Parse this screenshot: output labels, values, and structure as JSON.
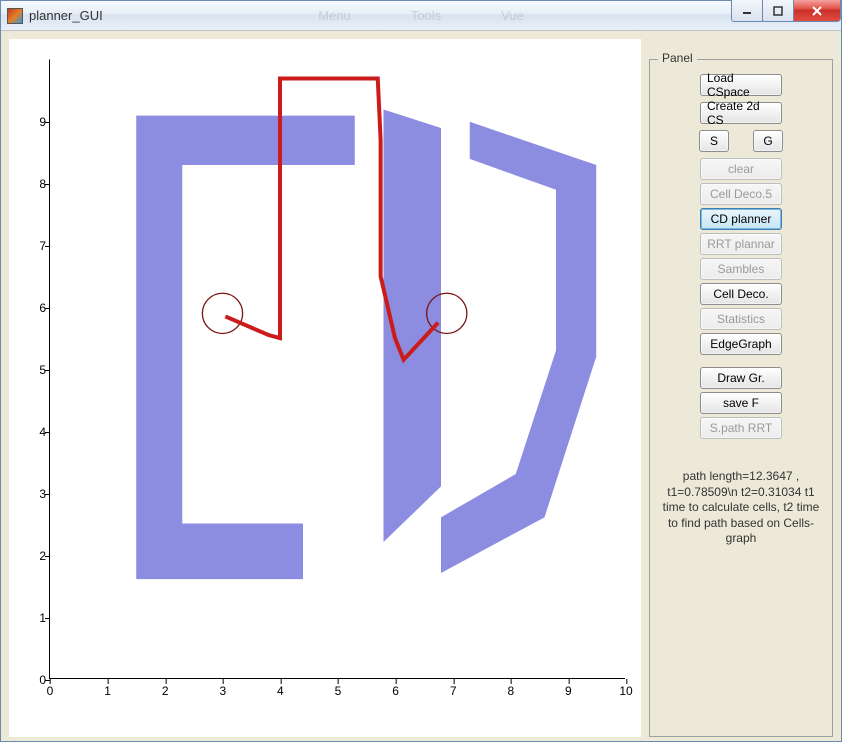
{
  "window": {
    "title": "planner_GUI",
    "ghost_menu": [
      "Menu",
      "Tools",
      "Vue"
    ]
  },
  "panel": {
    "title": "Panel",
    "buttons": {
      "load_cspace": "Load CSpace",
      "create_2d_cs": "Create 2d CS",
      "s": "S",
      "g": "G",
      "clear": "clear",
      "cell_deco5": "Cell Deco.5",
      "cd_planner": "CD planner",
      "rrt_planner": "RRT plannar",
      "sambles": "Sambles",
      "cell_deco": "Cell Deco.",
      "statistics": "Statistics",
      "edgegraph": "EdgeGraph",
      "draw_gr": "Draw Gr.",
      "save_f": "save F",
      "spath_rrt": "S.path RRT"
    },
    "status": "path length=12.3647 , t1=0.78509\\n t2=0.31034 t1 time to calculate cells, t2 time to find path based on Cells-graph"
  },
  "chart_data": {
    "type": "line",
    "title": "",
    "xlabel": "",
    "ylabel": "",
    "xlim": [
      0,
      10
    ],
    "ylim": [
      0,
      10
    ],
    "xticks": [
      0,
      1,
      2,
      3,
      4,
      5,
      6,
      7,
      8,
      9,
      10
    ],
    "yticks": [
      0,
      1,
      2,
      3,
      4,
      5,
      6,
      7,
      8,
      9
    ],
    "obstacles_color": "#8c8ce0",
    "path_color": "#cc1b1b",
    "circle_color": "#7a1313",
    "obstacles": [
      [
        [
          1.5,
          9.1
        ],
        [
          5.3,
          9.1
        ],
        [
          5.3,
          8.3
        ],
        [
          2.3,
          8.3
        ],
        [
          2.3,
          2.5
        ],
        [
          4.4,
          2.5
        ],
        [
          4.4,
          1.6
        ],
        [
          1.5,
          1.6
        ]
      ],
      [
        [
          5.8,
          9.2
        ],
        [
          6.8,
          8.9
        ],
        [
          6.8,
          3.1
        ],
        [
          5.8,
          2.2
        ]
      ],
      [
        [
          7.3,
          9.0
        ],
        [
          9.5,
          8.3
        ],
        [
          9.5,
          5.2
        ],
        [
          8.6,
          2.6
        ],
        [
          6.8,
          1.7
        ],
        [
          6.8,
          2.6
        ],
        [
          8.1,
          3.3
        ],
        [
          8.8,
          5.3
        ],
        [
          8.8,
          7.9
        ],
        [
          7.3,
          8.4
        ]
      ]
    ],
    "start_circle": {
      "cx": 3.0,
      "cy": 5.9,
      "r": 0.35
    },
    "goal_circle": {
      "cx": 6.9,
      "cy": 5.9,
      "r": 0.35
    },
    "path": [
      [
        3.05,
        5.85
      ],
      [
        3.8,
        5.55
      ],
      [
        4.0,
        5.5
      ],
      [
        4.0,
        9.7
      ],
      [
        5.7,
        9.7
      ],
      [
        5.75,
        8.7
      ],
      [
        5.75,
        6.5
      ],
      [
        6.0,
        5.5
      ],
      [
        6.15,
        5.15
      ],
      [
        6.75,
        5.75
      ]
    ]
  }
}
